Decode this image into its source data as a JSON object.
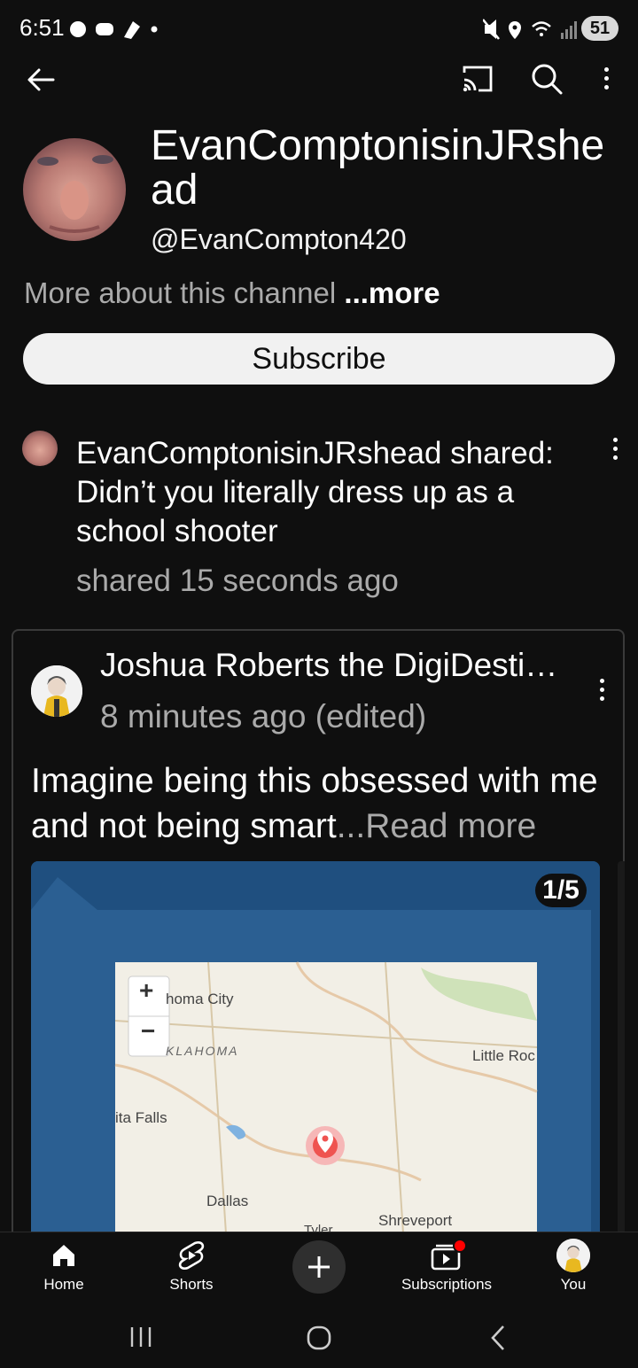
{
  "status_bar": {
    "time": "6:51",
    "battery": "51"
  },
  "top_bar": {
    "back_icon": "arrow-left-icon",
    "cast_icon": "cast-icon",
    "search_icon": "search-icon",
    "menu_icon": "more-vert-icon"
  },
  "channel": {
    "name": "EvanComptonisinJRshead",
    "handle": "@EvanCompton420",
    "about_text": "More about this channel",
    "about_more": "...more",
    "subscribe_label": "Subscribe"
  },
  "share_post": {
    "text": "EvanComptonisinJRshead shared: Didn’t you literally dress up as a school shooter",
    "time": "shared 15 seconds ago"
  },
  "original_post": {
    "author": "Joshua Roberts the DigiDestined",
    "time": "8 minutes ago (edited)",
    "body": "Imagine being this obsessed with me and not being smart",
    "read_more": "...Read more",
    "image_counter": "1/5",
    "map_labels": {
      "city1": "homa City",
      "state": "KLAHOMA",
      "city2": "Little Roc",
      "city3": "ita Falls",
      "city4": "Dallas",
      "city5": "Shreveport",
      "city6": "Tyler",
      "zoom_in": "+",
      "zoom_out": "−"
    }
  },
  "bottom_nav": {
    "items": [
      {
        "label": "Home",
        "icon": "home-icon"
      },
      {
        "label": "Shorts",
        "icon": "shorts-icon"
      },
      {
        "label": "",
        "icon": "create-plus-icon"
      },
      {
        "label": "Subscriptions",
        "icon": "subscriptions-icon"
      },
      {
        "label": "You",
        "icon": "you-avatar"
      }
    ]
  },
  "colors": {
    "background": "#0f0f0f",
    "secondary_text": "#aaaaaa",
    "notification_dot": "#ff0000",
    "map_water": "#1f4f7f"
  }
}
